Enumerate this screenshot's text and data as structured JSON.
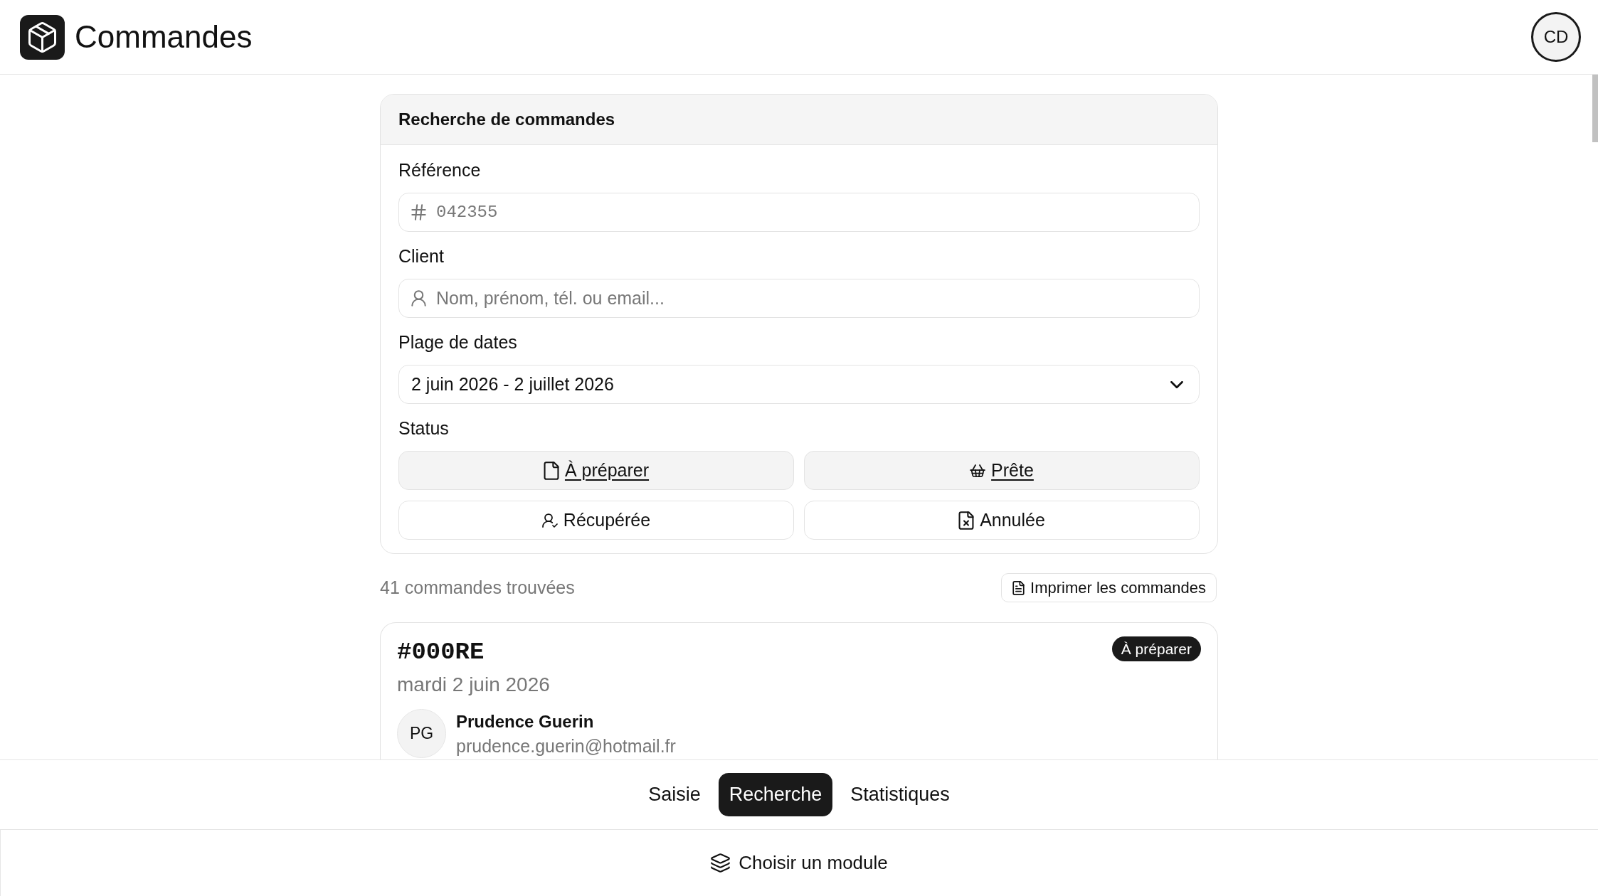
{
  "header": {
    "title": "Commandes",
    "user_initials": "CD"
  },
  "search_panel": {
    "title": "Recherche de commandes",
    "reference": {
      "label": "Référence",
      "placeholder": "042355"
    },
    "client": {
      "label": "Client",
      "placeholder": "Nom, prénom, tél. ou email..."
    },
    "date_range": {
      "label": "Plage de dates",
      "value": "2 juin 2026 - 2 juillet 2026"
    },
    "status": {
      "label": "Status",
      "options": [
        {
          "label": "À préparer",
          "selected": true
        },
        {
          "label": "Prête",
          "selected": true
        },
        {
          "label": "Récupérée",
          "selected": false
        },
        {
          "label": "Annulée",
          "selected": false
        }
      ]
    }
  },
  "results": {
    "count": "41 commandes trouvées",
    "print_button": "Imprimer les commandes"
  },
  "orders": [
    {
      "reference": "#000RE",
      "status": "À préparer",
      "date": "mardi 2 juin 2026",
      "initials": "PG",
      "customer": "Prudence Guerin",
      "email": "prudence.guerin@hotmail.fr"
    }
  ],
  "bottom_nav": {
    "tabs": [
      {
        "label": "Saisie",
        "selected": false
      },
      {
        "label": "Recherche",
        "selected": true
      },
      {
        "label": "Statistiques",
        "selected": false
      }
    ]
  },
  "module_button": "Choisir un module"
}
